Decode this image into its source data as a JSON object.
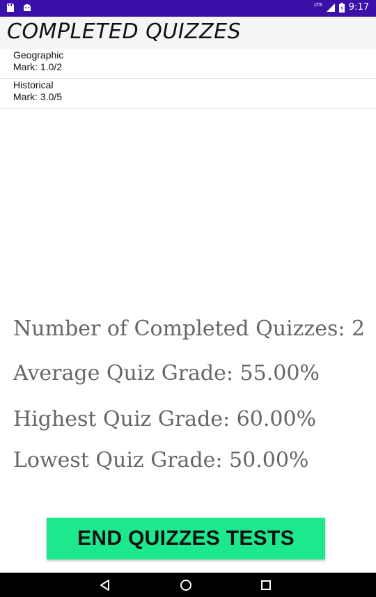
{
  "status_bar": {
    "time": "9:17",
    "network": "LTE",
    "icons": [
      "sd-card-icon",
      "android-debug-icon",
      "signal-icon",
      "battery-icon"
    ]
  },
  "header": {
    "title": "COMPLETED QUIZZES"
  },
  "quizzes": [
    {
      "name": "Geographic",
      "mark": "Mark: 1.0/2"
    },
    {
      "name": "Historical",
      "mark": "Mark: 3.0/5"
    }
  ],
  "stats": {
    "completed": "Number of Completed Quizzes: 2",
    "average": "Average Quiz Grade: 55.00%",
    "highest": "Highest Quiz Grade: 60.00%",
    "lowest": "Lowest Quiz Grade: 50.00%"
  },
  "actions": {
    "end_label": "END QUIZZES TESTS"
  },
  "nav_bar": {
    "icons": [
      "back-icon",
      "home-icon",
      "recents-icon"
    ]
  },
  "colors": {
    "status_bar": "#3a10a8",
    "button": "#1de88e",
    "stat_text": "#666666"
  }
}
